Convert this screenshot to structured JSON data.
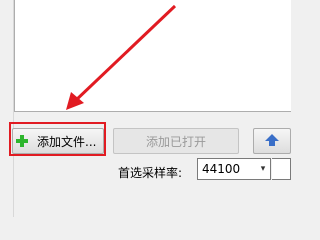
{
  "file_list": {
    "items": []
  },
  "buttons": {
    "add_file": "添加文件...",
    "add_opened": "添加已打开"
  },
  "sample_rate": {
    "label": "首选采样率:",
    "value": "44100"
  },
  "colors": {
    "annotation_red": "#e11b22",
    "plus_green": "#2db52d",
    "up_arrow_blue": "#3a6fc8"
  }
}
